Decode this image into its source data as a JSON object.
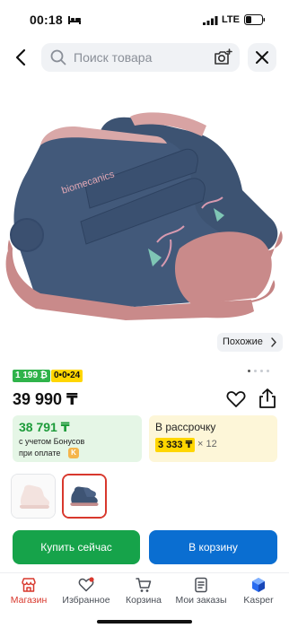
{
  "status_bar": {
    "time": "00:18",
    "network": "LTE"
  },
  "search": {
    "placeholder": "Поиск товара"
  },
  "product": {
    "brand_on_image": "biomecanics",
    "similar_label": "Похожие",
    "bonus_badge": "1 199 ₿",
    "installment_badge": "0•0•24",
    "price": "39 990 ₸",
    "bonus_price": "38 791 ₸",
    "bonus_note_line1": "с учетом Бонусов",
    "bonus_note_line2": "при оплате",
    "installment_title": "В рассрочку",
    "installment_amount": "3 333 ₸",
    "installment_months": "× 12",
    "gallery_count": 4,
    "gallery_active_index": 0
  },
  "actions": {
    "buy_now": "Купить сейчас",
    "add_to_cart": "В корзину"
  },
  "tabs": [
    {
      "label": "Магазин",
      "icon": "shop-icon",
      "active": true
    },
    {
      "label": "Избранное",
      "icon": "heart-icon",
      "active": false
    },
    {
      "label": "Корзина",
      "icon": "cart-icon",
      "active": false
    },
    {
      "label": "Мои заказы",
      "icon": "orders-icon",
      "active": false
    },
    {
      "label": "Kasper",
      "icon": "kaspi-logo-icon",
      "active": false
    }
  ],
  "colors": {
    "accent_red": "#d8382d",
    "buy_green": "#16a34a",
    "cart_blue": "#0a6ed1",
    "installment_yellow": "#ffd600",
    "shoe_navy": "#3f5573",
    "shoe_pink": "#c98a8a"
  }
}
